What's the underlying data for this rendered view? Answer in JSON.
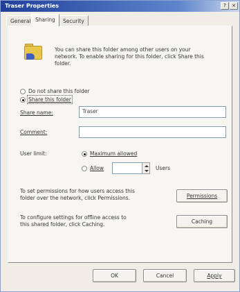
{
  "window": {
    "title": "Traser Properties",
    "help_btn": "?",
    "close_btn": "×"
  },
  "tabs": [
    "General",
    "Sharing",
    "Security"
  ],
  "info": {
    "line1": "You can share this folder among other users on your",
    "line2": "network.  To enable sharing for this folder, click Share this",
    "line3": "folder."
  },
  "sharing": {
    "do_not_share": "Do not share this folder",
    "share_this": "Share this folder",
    "share_name_label": "Share name:",
    "share_name_value": "Traser",
    "comment_label": "Comment:",
    "comment_value": "",
    "user_limit_label": "User limit:",
    "maximum_allowed": "Maximum allowed",
    "allow": "Allow",
    "users": "Users",
    "allow_value": ""
  },
  "permissions": {
    "text1": "To set permissions for how users access this",
    "text2": "folder over the network, click Permissions.",
    "button": "Permissions"
  },
  "caching": {
    "text1": "To configure settings for offline access to",
    "text2": "this shared folder, click Caching.",
    "button": "Caching"
  },
  "footer": {
    "ok": "OK",
    "cancel": "Cancel",
    "apply": "Apply"
  }
}
